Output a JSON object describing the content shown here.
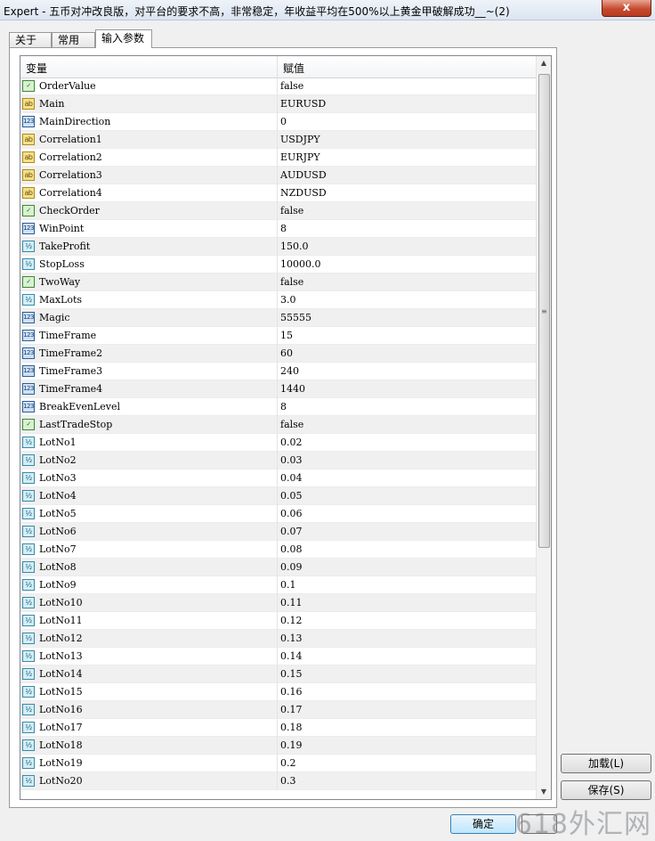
{
  "window": {
    "title": "Expert - 五币对冲改良版，对平台的要求不高，非常稳定，年收益平均在500%以上黄金甲破解成功__~(2)",
    "close_label": "x"
  },
  "tabs": [
    {
      "label": "关于"
    },
    {
      "label": "常用"
    },
    {
      "label": "输入参数",
      "active": true
    }
  ],
  "grid": {
    "header": {
      "variable": "变量",
      "value": "赋值"
    },
    "rows": [
      {
        "type": "bool",
        "icon": "boolean-icon",
        "name": "OrderValue",
        "value": "false"
      },
      {
        "type": "str",
        "icon": "string-icon",
        "name": "Main",
        "value": "EURUSD"
      },
      {
        "type": "int",
        "icon": "integer-icon",
        "name": "MainDirection",
        "value": "0"
      },
      {
        "type": "str",
        "icon": "string-icon",
        "name": "Correlation1",
        "value": "USDJPY"
      },
      {
        "type": "str",
        "icon": "string-icon",
        "name": "Correlation2",
        "value": "EURJPY"
      },
      {
        "type": "str",
        "icon": "string-icon",
        "name": "Correlation3",
        "value": "AUDUSD"
      },
      {
        "type": "str",
        "icon": "string-icon",
        "name": "Correlation4",
        "value": "NZDUSD"
      },
      {
        "type": "bool",
        "icon": "boolean-icon",
        "name": "CheckOrder",
        "value": "false"
      },
      {
        "type": "int",
        "icon": "integer-icon",
        "name": "WinPoint",
        "value": "8"
      },
      {
        "type": "dbl",
        "icon": "double-icon",
        "name": "TakeProfit",
        "value": "150.0"
      },
      {
        "type": "dbl",
        "icon": "double-icon",
        "name": "StopLoss",
        "value": "10000.0"
      },
      {
        "type": "bool",
        "icon": "boolean-icon",
        "name": "TwoWay",
        "value": "false"
      },
      {
        "type": "dbl",
        "icon": "double-icon",
        "name": "MaxLots",
        "value": "3.0"
      },
      {
        "type": "int",
        "icon": "integer-icon",
        "name": "Magic",
        "value": "55555"
      },
      {
        "type": "int",
        "icon": "integer-icon",
        "name": "TimeFrame",
        "value": "15"
      },
      {
        "type": "int",
        "icon": "integer-icon",
        "name": "TimeFrame2",
        "value": "60"
      },
      {
        "type": "int",
        "icon": "integer-icon",
        "name": "TimeFrame3",
        "value": "240"
      },
      {
        "type": "int",
        "icon": "integer-icon",
        "name": "TimeFrame4",
        "value": "1440"
      },
      {
        "type": "int",
        "icon": "integer-icon",
        "name": "BreakEvenLevel",
        "value": "8"
      },
      {
        "type": "bool",
        "icon": "boolean-icon",
        "name": "LastTradeStop",
        "value": "false"
      },
      {
        "type": "dbl",
        "icon": "double-icon",
        "name": "LotNo1",
        "value": "0.02"
      },
      {
        "type": "dbl",
        "icon": "double-icon",
        "name": "LotNo2",
        "value": "0.03"
      },
      {
        "type": "dbl",
        "icon": "double-icon",
        "name": "LotNo3",
        "value": "0.04"
      },
      {
        "type": "dbl",
        "icon": "double-icon",
        "name": "LotNo4",
        "value": "0.05"
      },
      {
        "type": "dbl",
        "icon": "double-icon",
        "name": "LotNo5",
        "value": "0.06"
      },
      {
        "type": "dbl",
        "icon": "double-icon",
        "name": "LotNo6",
        "value": "0.07"
      },
      {
        "type": "dbl",
        "icon": "double-icon",
        "name": "LotNo7",
        "value": "0.08"
      },
      {
        "type": "dbl",
        "icon": "double-icon",
        "name": "LotNo8",
        "value": "0.09"
      },
      {
        "type": "dbl",
        "icon": "double-icon",
        "name": "LotNo9",
        "value": "0.1"
      },
      {
        "type": "dbl",
        "icon": "double-icon",
        "name": "LotNo10",
        "value": "0.11"
      },
      {
        "type": "dbl",
        "icon": "double-icon",
        "name": "LotNo11",
        "value": "0.12"
      },
      {
        "type": "dbl",
        "icon": "double-icon",
        "name": "LotNo12",
        "value": "0.13"
      },
      {
        "type": "dbl",
        "icon": "double-icon",
        "name": "LotNo13",
        "value": "0.14"
      },
      {
        "type": "dbl",
        "icon": "double-icon",
        "name": "LotNo14",
        "value": "0.15"
      },
      {
        "type": "dbl",
        "icon": "double-icon",
        "name": "LotNo15",
        "value": "0.16"
      },
      {
        "type": "dbl",
        "icon": "double-icon",
        "name": "LotNo16",
        "value": "0.17"
      },
      {
        "type": "dbl",
        "icon": "double-icon",
        "name": "LotNo17",
        "value": "0.18"
      },
      {
        "type": "dbl",
        "icon": "double-icon",
        "name": "LotNo18",
        "value": "0.19"
      },
      {
        "type": "dbl",
        "icon": "double-icon",
        "name": "LotNo19",
        "value": "0.2"
      },
      {
        "type": "dbl",
        "icon": "double-icon",
        "name": "LotNo20",
        "value": "0.3"
      }
    ]
  },
  "icon_glyphs": {
    "bool": "✓",
    "str": "ab",
    "int": "123",
    "dbl": "½"
  },
  "buttons": {
    "load": "加载(L)",
    "save": "保存(S)",
    "ok": "确定",
    "cancel": ""
  },
  "watermark": "618外汇网"
}
